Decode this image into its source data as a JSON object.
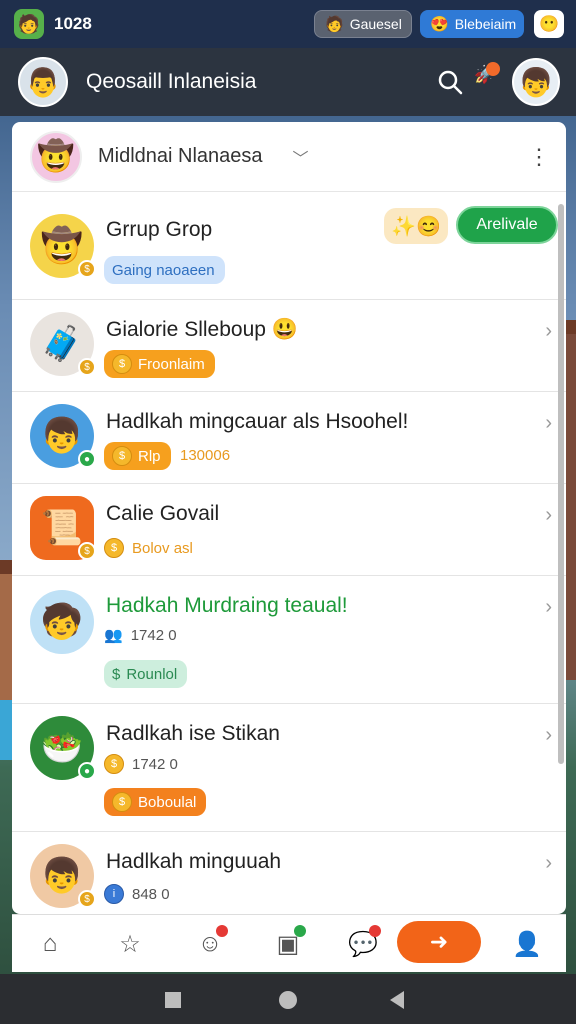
{
  "status_bar": {
    "time": "1028",
    "pill_left": "Gauesel",
    "pill_right": "Blebeiaim"
  },
  "header": {
    "title": "Qeosaill Inlaneisia"
  },
  "card": {
    "title": "Midldnai Nlanaesa"
  },
  "rows": [
    {
      "title": "Grrup Grop",
      "tag": "Gaing naoaeen",
      "button": "Arelivale"
    },
    {
      "title": "Gialorie Slleboup 😃",
      "tag": "Froonlaim"
    },
    {
      "title": "Hadlkah mingcauar als Hsoohel!",
      "tag": "Rlp",
      "meta": "130006"
    },
    {
      "title": "Calie Govail",
      "meta": "Bolov asl"
    },
    {
      "title": "Hadkah Murdraing teaual!",
      "meta": "1742  0",
      "tag": "Rounlol"
    },
    {
      "title": "Radlkah ise Stikan",
      "meta": "1742  0",
      "tag": "Boboulal"
    },
    {
      "title": "Hadlkah minguuah",
      "meta": "848  0"
    }
  ]
}
